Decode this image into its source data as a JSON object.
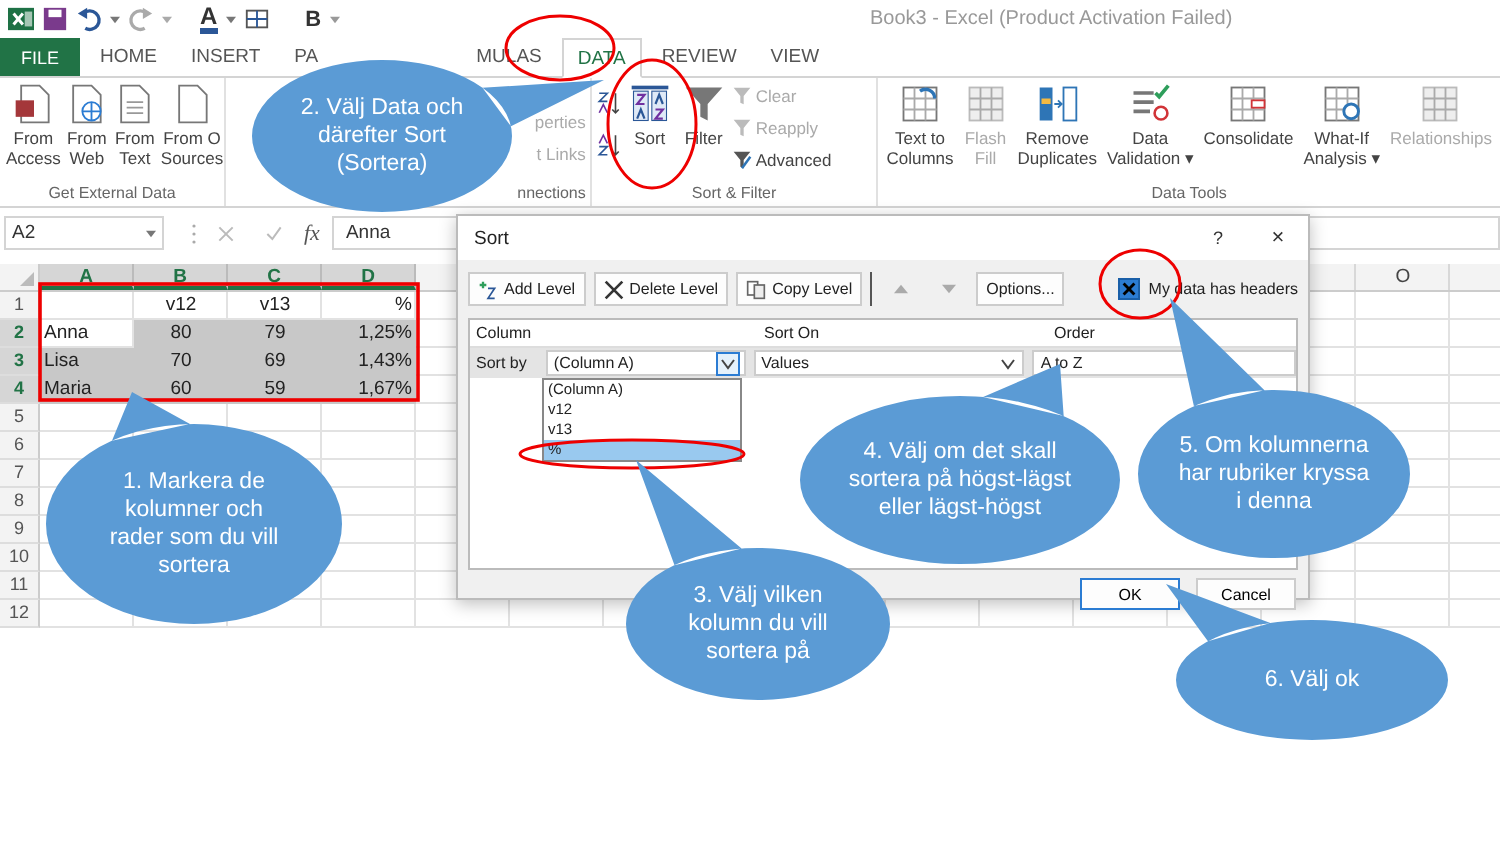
{
  "title_bar": {
    "font_color_letter": "A",
    "bold_letter": "B",
    "title": "Book3 - Excel (Product Activation Failed)"
  },
  "tabs": [
    {
      "label": "FILE",
      "kind": "file"
    },
    {
      "label": "HOME",
      "kind": "tab",
      "selected": false
    },
    {
      "label": "INSERT",
      "kind": "tab",
      "selected": false
    },
    {
      "label": "PA",
      "kind": "tab",
      "selected": false
    },
    {
      "label": "MULAS",
      "kind": "tab",
      "selected": false
    },
    {
      "label": "DATA",
      "kind": "tab",
      "selected": true
    },
    {
      "label": "REVIEW",
      "kind": "tab",
      "selected": false
    },
    {
      "label": "VIEW",
      "kind": "tab",
      "selected": false
    }
  ],
  "ribbon": {
    "groups": [
      {
        "label": "Get External Data",
        "items": [
          {
            "kind": "large",
            "label": "From\nAccess",
            "disabled": false
          },
          {
            "kind": "large",
            "label": "From\nWeb",
            "disabled": false
          },
          {
            "kind": "large",
            "label": "From\nText",
            "disabled": false
          },
          {
            "kind": "large",
            "label": "From O\nSources",
            "disabled": false
          }
        ]
      },
      {
        "label": "nnections",
        "items": [
          {
            "label": "perties",
            "disabled": true
          },
          {
            "label": "t Links",
            "disabled": true
          }
        ]
      },
      {
        "label": "Sort & Filter",
        "items": [
          {
            "kind": "sort-pair"
          },
          {
            "kind": "large",
            "label": "Sort",
            "disabled": false
          },
          {
            "kind": "large",
            "label": "Filter",
            "disabled": false
          },
          {
            "kind": "small",
            "label": "Clear",
            "disabled": true
          },
          {
            "kind": "small",
            "label": "Reapply",
            "disabled": true
          },
          {
            "kind": "small",
            "label": "Advanced",
            "disabled": false
          }
        ]
      },
      {
        "label": "Data Tools",
        "items": [
          {
            "kind": "large",
            "label": "Text to\nColumns",
            "disabled": false
          },
          {
            "kind": "large",
            "label": "Flash\nFill",
            "disabled": true
          },
          {
            "kind": "large",
            "label": "Remove\nDuplicates",
            "disabled": false
          },
          {
            "kind": "large",
            "label": "Data\nValidation ▾",
            "disabled": false
          },
          {
            "kind": "large",
            "label": "Consolidate",
            "disabled": false
          },
          {
            "kind": "large",
            "label": "What-If\nAnalysis ▾",
            "disabled": false
          },
          {
            "kind": "large",
            "label": "Relationships",
            "disabled": true
          }
        ]
      }
    ]
  },
  "formula_bar": {
    "name_box": "A2",
    "function_label": "fx",
    "formula": "Anna"
  },
  "sheet": {
    "columns": [
      {
        "label": "A",
        "selected": true
      },
      {
        "label": "B",
        "selected": true
      },
      {
        "label": "C",
        "selected": true
      },
      {
        "label": "D",
        "selected": true
      },
      {
        "label": "O",
        "selected": false
      }
    ],
    "rows": [
      {
        "label": "1",
        "selected": false,
        "cells": [
          null,
          {
            "text": "v12",
            "selected": false
          },
          {
            "text": "v13",
            "selected": false
          },
          {
            "text": "%",
            "selected": false
          }
        ]
      },
      {
        "label": "2",
        "selected": true,
        "cells": [
          {
            "text": "Anna",
            "selected": false
          },
          {
            "text": "80",
            "selected": true
          },
          {
            "text": "79",
            "selected": true
          },
          {
            "text": "1,25%",
            "selected": true
          }
        ]
      },
      {
        "label": "3",
        "selected": true,
        "cells": [
          {
            "text": "Lisa",
            "selected": true
          },
          {
            "text": "70",
            "selected": true
          },
          {
            "text": "69",
            "selected": true
          },
          {
            "text": "1,43%",
            "selected": true
          }
        ]
      },
      {
        "label": "4",
        "selected": true,
        "cells": [
          {
            "text": "Maria",
            "selected": true
          },
          {
            "text": "60",
            "selected": true
          },
          {
            "text": "59",
            "selected": true
          },
          {
            "text": "1,67%",
            "selected": true
          }
        ]
      },
      {
        "label": "5",
        "selected": false
      },
      {
        "label": "6",
        "selected": false
      },
      {
        "label": "7",
        "selected": false
      },
      {
        "label": "8",
        "selected": false
      },
      {
        "label": "9",
        "selected": false
      },
      {
        "label": "10",
        "selected": false
      },
      {
        "label": "11",
        "selected": false
      },
      {
        "label": "12",
        "selected": false
      }
    ]
  },
  "dialog": {
    "title": "Sort",
    "help": "?",
    "close": "×",
    "toolbar": [
      {
        "kind": "add",
        "label": "Add Level"
      },
      {
        "kind": "delete",
        "label": "Delete Level"
      },
      {
        "kind": "copy",
        "label": "Copy Level"
      },
      {
        "kind": "up",
        "disabled": true
      },
      {
        "kind": "down",
        "disabled": true
      },
      {
        "kind": "text",
        "label": "Options..."
      }
    ],
    "headers_checkbox": {
      "label": "My data has headers",
      "checked": true
    },
    "columns": [
      "Column",
      "Sort On",
      "Order"
    ],
    "level": {
      "label": "Sort by",
      "column": "(Column A)",
      "sort_on": "Values",
      "order": "A to Z"
    },
    "dropdown": [
      {
        "label": "(Column A)",
        "selected": false
      },
      {
        "label": "v12",
        "selected": false
      },
      {
        "label": "v13",
        "selected": false
      },
      {
        "label": "%",
        "selected": true
      }
    ],
    "buttons": [
      {
        "label": "OK",
        "default": true
      },
      {
        "label": "Cancel",
        "default": false
      }
    ]
  },
  "callouts": [
    {
      "text": "1. Markera de kolumner och rader som du vill sortera"
    },
    {
      "text": "2. Välj Data och därefter Sort (Sortera)"
    },
    {
      "text": "3. Välj vilken kolumn du vill sortera på"
    },
    {
      "text": "4. Välj om det skall sortera på högst-lägst eller lägst-högst"
    },
    {
      "text": "5. Om kolumnerna har rubriker kryssa i denna"
    },
    {
      "text": "6. Välj ok"
    }
  ]
}
